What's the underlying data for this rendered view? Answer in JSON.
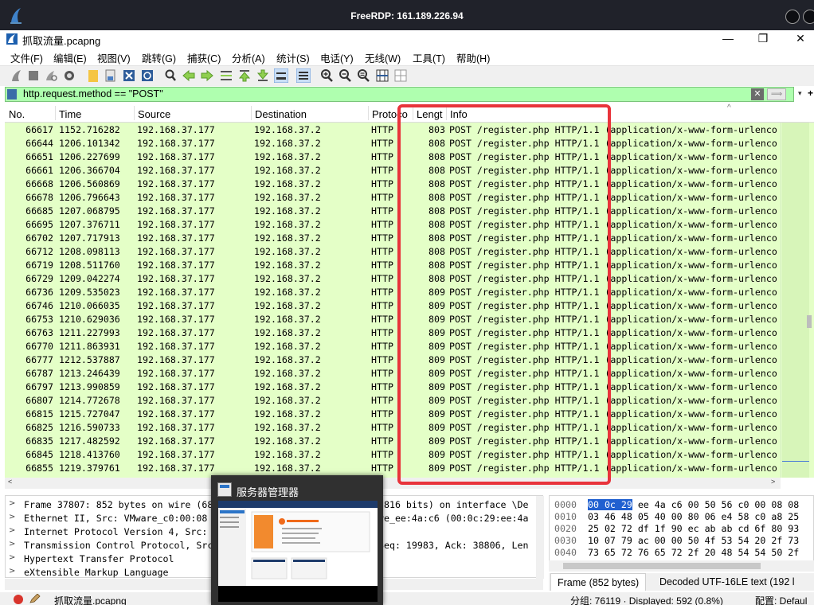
{
  "rdp": {
    "title": "FreeRDP: 161.189.226.94"
  },
  "window": {
    "title": "抓取流量.pcapng",
    "minimize": "—",
    "maximize": "❐",
    "close": "✕"
  },
  "menu": [
    "文件(F)",
    "编辑(E)",
    "视图(V)",
    "跳转(G)",
    "捕获(C)",
    "分析(A)",
    "统计(S)",
    "电话(Y)",
    "无线(W)",
    "工具(T)",
    "帮助(H)"
  ],
  "toolbar": {
    "icons": [
      "shark-start-icon",
      "stop-icon",
      "restart-icon",
      "options-icon",
      "open-icon",
      "file-set-icon",
      "close-file-icon",
      "reload-icon",
      "find-icon",
      "back-icon",
      "forward-icon",
      "goto-icon",
      "first-icon",
      "last-icon",
      "autoscroll-icon",
      "colorize-icon",
      "zoom-in-icon",
      "zoom-out-icon",
      "zoom-normal-icon",
      "resize-columns-icon",
      "layout-icon"
    ]
  },
  "filter": {
    "value": "http.request.method == \"POST\"",
    "clear_label": "✕",
    "apply_label": "⟹",
    "dropdown_label": "▾",
    "add_label": "+"
  },
  "packet_list": {
    "columns": [
      "No.",
      "Time",
      "Source",
      "Destination",
      "Protoco",
      "Lengt",
      "Info"
    ],
    "rows": [
      {
        "no": "66617",
        "time": "1152.716282",
        "src": "192.168.37.177",
        "dst": "192.168.37.2",
        "proto": "HTTP",
        "len": "803",
        "info": "POST /register.php HTTP/1.1  (application/x-www-form-urlenco"
      },
      {
        "no": "66644",
        "time": "1206.101342",
        "src": "192.168.37.177",
        "dst": "192.168.37.2",
        "proto": "HTTP",
        "len": "808",
        "info": "POST /register.php HTTP/1.1  (application/x-www-form-urlenco"
      },
      {
        "no": "66651",
        "time": "1206.227699",
        "src": "192.168.37.177",
        "dst": "192.168.37.2",
        "proto": "HTTP",
        "len": "808",
        "info": "POST /register.php HTTP/1.1  (application/x-www-form-urlenco"
      },
      {
        "no": "66661",
        "time": "1206.366704",
        "src": "192.168.37.177",
        "dst": "192.168.37.2",
        "proto": "HTTP",
        "len": "808",
        "info": "POST /register.php HTTP/1.1  (application/x-www-form-urlenco"
      },
      {
        "no": "66668",
        "time": "1206.560869",
        "src": "192.168.37.177",
        "dst": "192.168.37.2",
        "proto": "HTTP",
        "len": "808",
        "info": "POST /register.php HTTP/1.1  (application/x-www-form-urlenco"
      },
      {
        "no": "66678",
        "time": "1206.796643",
        "src": "192.168.37.177",
        "dst": "192.168.37.2",
        "proto": "HTTP",
        "len": "808",
        "info": "POST /register.php HTTP/1.1  (application/x-www-form-urlenco"
      },
      {
        "no": "66685",
        "time": "1207.068795",
        "src": "192.168.37.177",
        "dst": "192.168.37.2",
        "proto": "HTTP",
        "len": "808",
        "info": "POST /register.php HTTP/1.1  (application/x-www-form-urlenco"
      },
      {
        "no": "66695",
        "time": "1207.376711",
        "src": "192.168.37.177",
        "dst": "192.168.37.2",
        "proto": "HTTP",
        "len": "808",
        "info": "POST /register.php HTTP/1.1  (application/x-www-form-urlenco"
      },
      {
        "no": "66702",
        "time": "1207.717913",
        "src": "192.168.37.177",
        "dst": "192.168.37.2",
        "proto": "HTTP",
        "len": "808",
        "info": "POST /register.php HTTP/1.1  (application/x-www-form-urlenco"
      },
      {
        "no": "66712",
        "time": "1208.098113",
        "src": "192.168.37.177",
        "dst": "192.168.37.2",
        "proto": "HTTP",
        "len": "808",
        "info": "POST /register.php HTTP/1.1  (application/x-www-form-urlenco"
      },
      {
        "no": "66719",
        "time": "1208.511760",
        "src": "192.168.37.177",
        "dst": "192.168.37.2",
        "proto": "HTTP",
        "len": "808",
        "info": "POST /register.php HTTP/1.1  (application/x-www-form-urlenco"
      },
      {
        "no": "66729",
        "time": "1209.042274",
        "src": "192.168.37.177",
        "dst": "192.168.37.2",
        "proto": "HTTP",
        "len": "808",
        "info": "POST /register.php HTTP/1.1  (application/x-www-form-urlenco"
      },
      {
        "no": "66736",
        "time": "1209.535023",
        "src": "192.168.37.177",
        "dst": "192.168.37.2",
        "proto": "HTTP",
        "len": "809",
        "info": "POST /register.php HTTP/1.1  (application/x-www-form-urlenco"
      },
      {
        "no": "66746",
        "time": "1210.066035",
        "src": "192.168.37.177",
        "dst": "192.168.37.2",
        "proto": "HTTP",
        "len": "809",
        "info": "POST /register.php HTTP/1.1  (application/x-www-form-urlenco"
      },
      {
        "no": "66753",
        "time": "1210.629036",
        "src": "192.168.37.177",
        "dst": "192.168.37.2",
        "proto": "HTTP",
        "len": "809",
        "info": "POST /register.php HTTP/1.1  (application/x-www-form-urlenco"
      },
      {
        "no": "66763",
        "time": "1211.227993",
        "src": "192.168.37.177",
        "dst": "192.168.37.2",
        "proto": "HTTP",
        "len": "809",
        "info": "POST /register.php HTTP/1.1  (application/x-www-form-urlenco"
      },
      {
        "no": "66770",
        "time": "1211.863931",
        "src": "192.168.37.177",
        "dst": "192.168.37.2",
        "proto": "HTTP",
        "len": "809",
        "info": "POST /register.php HTTP/1.1  (application/x-www-form-urlenco"
      },
      {
        "no": "66777",
        "time": "1212.537887",
        "src": "192.168.37.177",
        "dst": "192.168.37.2",
        "proto": "HTTP",
        "len": "809",
        "info": "POST /register.php HTTP/1.1  (application/x-www-form-urlenco"
      },
      {
        "no": "66787",
        "time": "1213.246439",
        "src": "192.168.37.177",
        "dst": "192.168.37.2",
        "proto": "HTTP",
        "len": "809",
        "info": "POST /register.php HTTP/1.1  (application/x-www-form-urlenco"
      },
      {
        "no": "66797",
        "time": "1213.990859",
        "src": "192.168.37.177",
        "dst": "192.168.37.2",
        "proto": "HTTP",
        "len": "809",
        "info": "POST /register.php HTTP/1.1  (application/x-www-form-urlenco"
      },
      {
        "no": "66807",
        "time": "1214.772678",
        "src": "192.168.37.177",
        "dst": "192.168.37.2",
        "proto": "HTTP",
        "len": "809",
        "info": "POST /register.php HTTP/1.1  (application/x-www-form-urlenco"
      },
      {
        "no": "66815",
        "time": "1215.727047",
        "src": "192.168.37.177",
        "dst": "192.168.37.2",
        "proto": "HTTP",
        "len": "809",
        "info": "POST /register.php HTTP/1.1  (application/x-www-form-urlenco"
      },
      {
        "no": "66825",
        "time": "1216.590733",
        "src": "192.168.37.177",
        "dst": "192.168.37.2",
        "proto": "HTTP",
        "len": "809",
        "info": "POST /register.php HTTP/1.1  (application/x-www-form-urlenco"
      },
      {
        "no": "66835",
        "time": "1217.482592",
        "src": "192.168.37.177",
        "dst": "192.168.37.2",
        "proto": "HTTP",
        "len": "809",
        "info": "POST /register.php HTTP/1.1  (application/x-www-form-urlenco"
      },
      {
        "no": "66845",
        "time": "1218.413760",
        "src": "192.168.37.177",
        "dst": "192.168.37.2",
        "proto": "HTTP",
        "len": "809",
        "info": "POST /register.php HTTP/1.1  (application/x-www-form-urlenco"
      },
      {
        "no": "66855",
        "time": "1219.379761",
        "src": "192.168.37.177",
        "dst": "192.168.37.2",
        "proto": "HTTP",
        "len": "809",
        "info": "POST /register.php HTTP/1.1  (application/x-www-form-urlenco"
      }
    ]
  },
  "details": [
    "Frame 37807: 852 bytes on wire (68",
    "Ethernet II, Src: VMware_c0:00:08",
    "Internet Protocol Version 4, Src:",
    "Transmission Control Protocol, Src",
    "Hypertext Transfer Protocol",
    "eXtensible Markup Language"
  ],
  "details_visible_tail": [
    "5816 bits) on interface \\De",
    "re_ee:4a:c6 (00:0c:29:ee:4a",
    "2",
    "Seq: 19983, Ack: 38806, Len",
    "",
    ""
  ],
  "hex": {
    "rows": [
      {
        "off": "0000",
        "sel": "00 0c 29",
        "bytes": " ee 4a c6 00 50  56 c0 00 08 08"
      },
      {
        "off": "0010",
        "sel": "",
        "bytes": "03 46 48 05 40 00 80 06  e4 58 c0 a8 25"
      },
      {
        "off": "0020",
        "sel": "",
        "bytes": "25 02 72 df 1f 90 ec ab  ab cd 6f 80 93"
      },
      {
        "off": "0030",
        "sel": "",
        "bytes": "10 07 79 ac 00 00 50 4f  53 54 20 2f 73"
      },
      {
        "off": "0040",
        "sel": "",
        "bytes": "73 65 72 76 65 72 2f 20  48 54 54 50 2f"
      }
    ]
  },
  "tabs": [
    "Frame (852 bytes)",
    "Decoded UTF-16LE text (192 l"
  ],
  "status": {
    "file": "抓取流量.pcapng",
    "packets": "分组: 76119 · Displayed: 592 (0.8%)",
    "profile": "配置: Defaul"
  },
  "popup": {
    "title": "服务器管理器"
  },
  "colors": {
    "rdp_bar": "#20222a",
    "filter_bg": "#afffaf",
    "row_bg": "#e4ffc7",
    "highlight": "#e8343b",
    "hex_select": "#2060d0"
  }
}
